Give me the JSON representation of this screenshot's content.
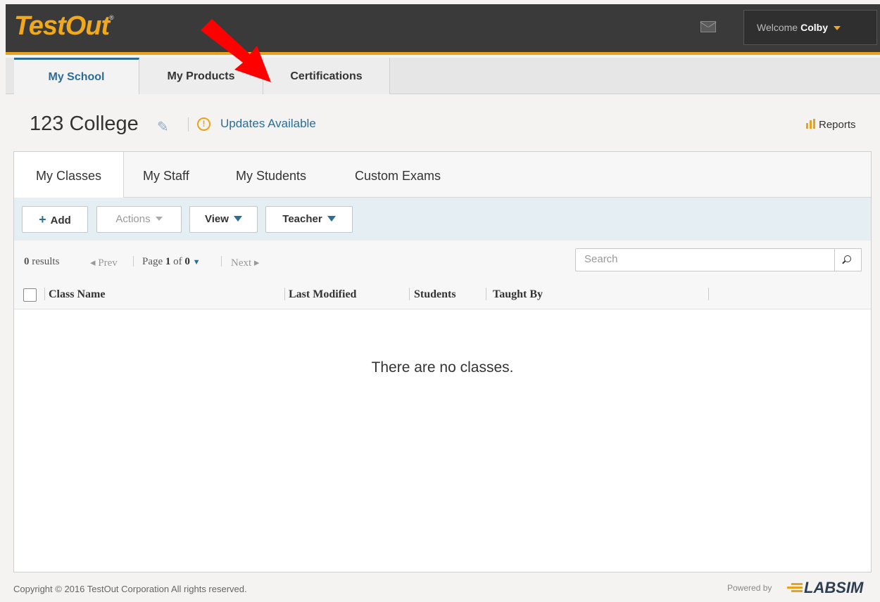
{
  "header": {
    "logo": "TestOut",
    "logo_mark": "®",
    "welcome_prefix": "Welcome",
    "user_name": "Colby"
  },
  "nav": {
    "tabs": [
      {
        "label": "My School",
        "active": true
      },
      {
        "label": "My Products",
        "active": false
      },
      {
        "label": "Certifications",
        "active": false
      }
    ]
  },
  "page": {
    "school_name": "123 College",
    "updates_label": "Updates Available",
    "reports_label": "Reports"
  },
  "subtabs": [
    {
      "label": "My Classes",
      "active": true
    },
    {
      "label": "My Staff",
      "active": false
    },
    {
      "label": "My Students",
      "active": false
    },
    {
      "label": "Custom Exams",
      "active": false
    }
  ],
  "toolbar": {
    "add_label": "Add",
    "actions_label": "Actions",
    "view_label": "View",
    "teacher_label": "Teacher"
  },
  "pager": {
    "results_count": "0",
    "results_label": "results",
    "prev_label": "Prev",
    "page_prefix": "Page",
    "page_current": "1",
    "page_of": "of",
    "page_total": "0",
    "next_label": "Next"
  },
  "search": {
    "placeholder": "Search"
  },
  "table": {
    "columns": [
      "Class Name",
      "Last Modified",
      "Students",
      "Taught By"
    ],
    "empty_message": "There are no classes."
  },
  "footer": {
    "copyright": "Copyright © 2016 TestOut Corporation All rights reserved.",
    "powered_by": "Powered by",
    "brand": "LABSIM"
  },
  "colors": {
    "accent_orange": "#e8a21b",
    "link_blue": "#2b6d95",
    "topbar_bg": "#3a3a3a",
    "annotation_arrow": "#ff0000"
  }
}
